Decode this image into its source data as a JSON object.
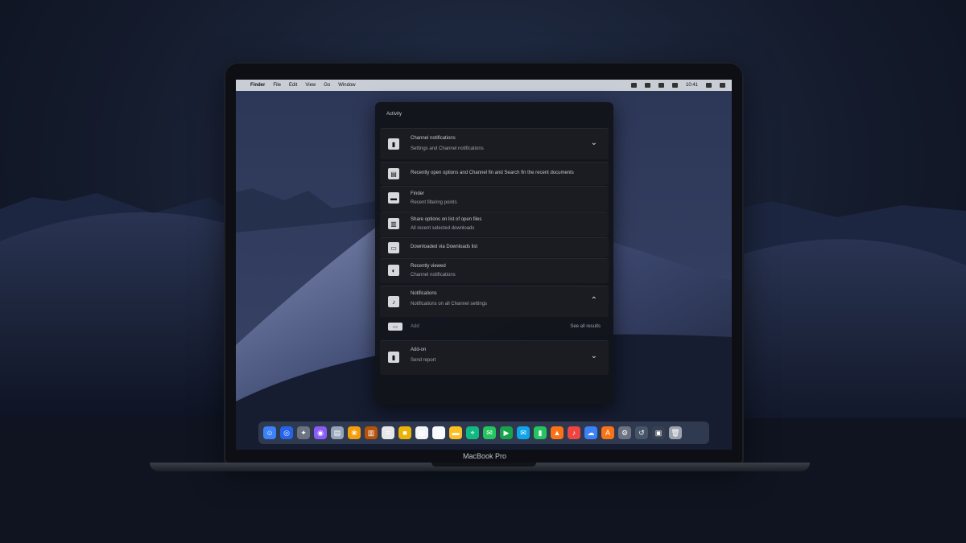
{
  "menubar": {
    "left": [
      "Finder",
      "File",
      "Edit",
      "View",
      "Go",
      "Window"
    ],
    "right_time": "10:41"
  },
  "panel": {
    "title": "Activity",
    "rows": [
      {
        "line1": "Channel notifications",
        "line2": "Settings and Channel notifications",
        "chevron": "⌄"
      },
      {
        "line1": "Recently open options and Channel fin and Search fin the recent documents",
        "line2": ""
      },
      {
        "line1": "Finder",
        "line2": "Recent filtering points"
      },
      {
        "line1": "Share options on list of open files",
        "line2": "All recent selected downloads"
      },
      {
        "line1": "Downloaded via Downloads list",
        "line2": ""
      },
      {
        "line1": "Recently viewed",
        "line2": "Channel notifications"
      },
      {
        "line1": "Notifications",
        "line2": "Notifications on all Channel settings",
        "chevron": "⌃"
      },
      {
        "line1": "Add",
        "line2": "",
        "right": "See all results"
      },
      {
        "line1": "Add-on",
        "line2": "Send report",
        "chevron": "⌄"
      }
    ]
  },
  "device_label": "MacBook Pro",
  "dock": {
    "items": [
      {
        "name": "finder-icon",
        "color": "#3b82f6",
        "glyph": "☺"
      },
      {
        "name": "safari-icon",
        "color": "#2563eb",
        "glyph": "◎"
      },
      {
        "name": "launchpad-icon",
        "color": "#6b7280",
        "glyph": "✦"
      },
      {
        "name": "siri-icon",
        "color": "#8b5cf6",
        "glyph": "◉"
      },
      {
        "name": "preview-icon",
        "color": "#94a3b8",
        "glyph": "▤"
      },
      {
        "name": "photos-icon",
        "color": "#f59e0b",
        "glyph": "❀"
      },
      {
        "name": "contacts-icon",
        "color": "#b45309",
        "glyph": "▥"
      },
      {
        "name": "notes-icon",
        "color": "#e5e7eb",
        "glyph": "≡"
      },
      {
        "name": "stickies-icon",
        "color": "#eab308",
        "glyph": "■"
      },
      {
        "name": "calendar-icon",
        "color": "#f3f4f6",
        "glyph": "▦"
      },
      {
        "name": "textedit-icon",
        "color": "#f8fafc",
        "glyph": "≣"
      },
      {
        "name": "folder-icon",
        "color": "#fbbf24",
        "glyph": "▬"
      },
      {
        "name": "maps-icon",
        "color": "#10b981",
        "glyph": "⌖"
      },
      {
        "name": "messages-icon",
        "color": "#22c55e",
        "glyph": "✉"
      },
      {
        "name": "facetime-icon",
        "color": "#16a34a",
        "glyph": "▶"
      },
      {
        "name": "mail-icon",
        "color": "#0ea5e9",
        "glyph": "✉"
      },
      {
        "name": "numbers-icon",
        "color": "#22c55e",
        "glyph": "▮"
      },
      {
        "name": "keynote-icon",
        "color": "#f97316",
        "glyph": "▲"
      },
      {
        "name": "music-icon",
        "color": "#ef4444",
        "glyph": "♪"
      },
      {
        "name": "icloud-icon",
        "color": "#3b82f6",
        "glyph": "☁"
      },
      {
        "name": "app-store-icon",
        "color": "#f97316",
        "glyph": "A"
      },
      {
        "name": "settings-icon",
        "color": "#6b7280",
        "glyph": "⚙"
      },
      {
        "name": "timemachine-icon",
        "color": "#475569",
        "glyph": "↺"
      },
      {
        "name": "screen-icon",
        "color": "#374151",
        "glyph": "▣"
      },
      {
        "name": "trash-icon",
        "color": "#9ca3af",
        "glyph": "🗑"
      }
    ]
  }
}
